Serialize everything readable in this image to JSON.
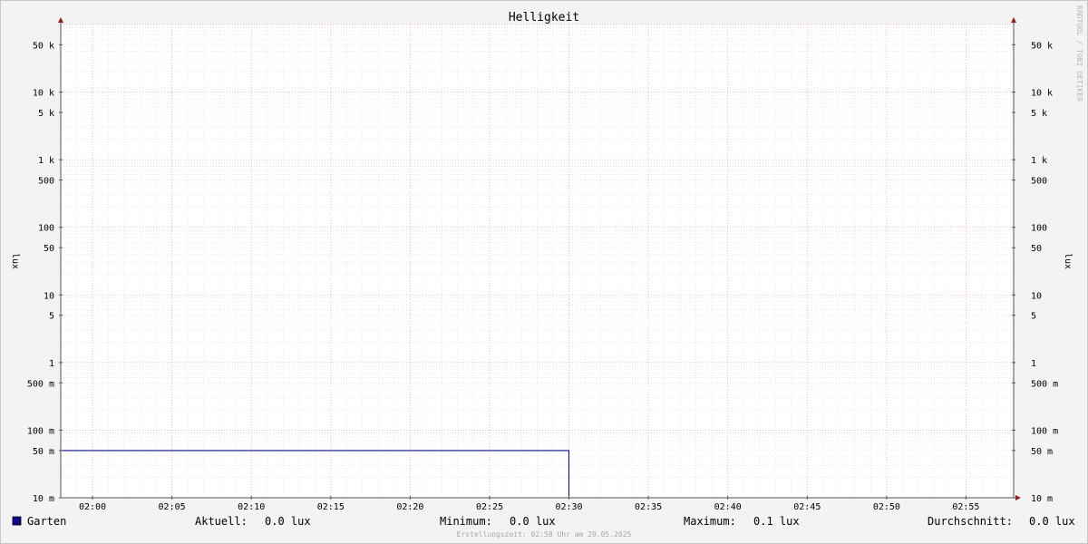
{
  "colors": {
    "background": "#f3f3f3",
    "canvas": "#ffffff",
    "minor_grid": "#dcdcdc",
    "major_grid": "#f0a6ad",
    "axis": "#555555",
    "arrow": "#9a1a1a",
    "series": "#0b0b8c"
  },
  "credit": "RRDTOOL / TOBI OETIKER",
  "footer": "Erstellungszeit: 02:58 Uhr am 29.05.2025",
  "chart_data": {
    "type": "line",
    "title": "Helligkeit",
    "ylabel": "lux",
    "yscale": "log",
    "ylim": [
      0.01,
      100000
    ],
    "xlim": [
      "01:58:00",
      "02:58:00"
    ],
    "grid": true,
    "y_ticks": [
      {
        "value": 50000,
        "label": "50 k"
      },
      {
        "value": 10000,
        "label": "10 k"
      },
      {
        "value": 5000,
        "label": "5 k"
      },
      {
        "value": 1000,
        "label": "1 k"
      },
      {
        "value": 500,
        "label": "500"
      },
      {
        "value": 100,
        "label": "100"
      },
      {
        "value": 50,
        "label": "50"
      },
      {
        "value": 10,
        "label": "10"
      },
      {
        "value": 5,
        "label": "5"
      },
      {
        "value": 1,
        "label": "1"
      },
      {
        "value": 0.5,
        "label": "500 m"
      },
      {
        "value": 0.1,
        "label": "100 m"
      },
      {
        "value": 0.05,
        "label": "50 m"
      },
      {
        "value": 0.01,
        "label": "10 m"
      }
    ],
    "x_ticks": [
      "02:00",
      "02:05",
      "02:10",
      "02:15",
      "02:20",
      "02:25",
      "02:30",
      "02:35",
      "02:40",
      "02:45",
      "02:50",
      "02:55"
    ],
    "series": [
      {
        "name": "Garten",
        "color": "#0b0b8c",
        "points": [
          {
            "x": "01:58:00",
            "y": 0.05
          },
          {
            "x": "02:30:00",
            "y": 0.05
          },
          {
            "x": "02:30:00",
            "y": 0.0
          },
          {
            "x": "02:58:00",
            "y": 0.0
          }
        ]
      }
    ]
  },
  "legend": {
    "series_name": "Garten",
    "aktuell_label": "Aktuell:",
    "aktuell_value": "0.0 lux",
    "minimum_label": "Minimum:",
    "minimum_value": "0.0 lux",
    "maximum_label": "Maximum:",
    "maximum_value": "0.1 lux",
    "durchschnitt_label": "Durchschnitt:",
    "durchschnitt_value": "0.0 lux"
  }
}
